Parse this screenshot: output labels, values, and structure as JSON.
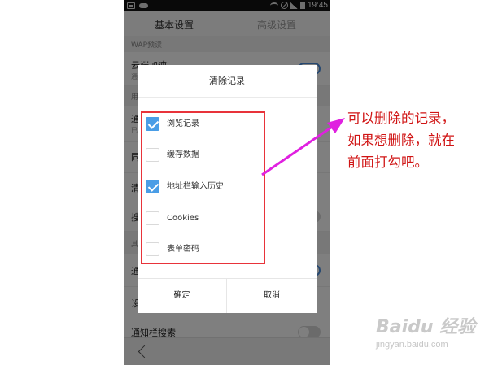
{
  "status_bar": {
    "time": "19:45"
  },
  "tabs": {
    "basic": "基本设置",
    "advanced": "高级设置"
  },
  "background": {
    "section_wap": "WAP预读",
    "row_cloud": "云端加速",
    "row_cloud_sub": "通",
    "section_2": "用",
    "row_2": "通",
    "row_2_sub": "已",
    "row_3": "同",
    "row_4": "清",
    "row_5": "搜",
    "section_3": "其",
    "row_6": "通",
    "row_7": "设",
    "row_notify": "通知栏搜索"
  },
  "dialog": {
    "title": "清除记录",
    "options": [
      {
        "label": "浏览记录",
        "checked": true
      },
      {
        "label": "缓存数据",
        "checked": false
      },
      {
        "label": "地址栏输入历史",
        "checked": true
      },
      {
        "label": "Cookies",
        "checked": false
      },
      {
        "label": "表单密码",
        "checked": false
      }
    ],
    "confirm": "确定",
    "cancel": "取消"
  },
  "annotation": {
    "line1": "可以删除的记录，",
    "line2": "如果想删除，就在",
    "line3": "前面打勾吧。"
  },
  "watermark": {
    "logo": "Baidu 经验",
    "url": "jingyan.baidu.com"
  },
  "colors": {
    "accent": "#4a9de6",
    "highlight": "#e8333a",
    "annotation_text": "#d01414",
    "arrow": "#e020e0"
  }
}
